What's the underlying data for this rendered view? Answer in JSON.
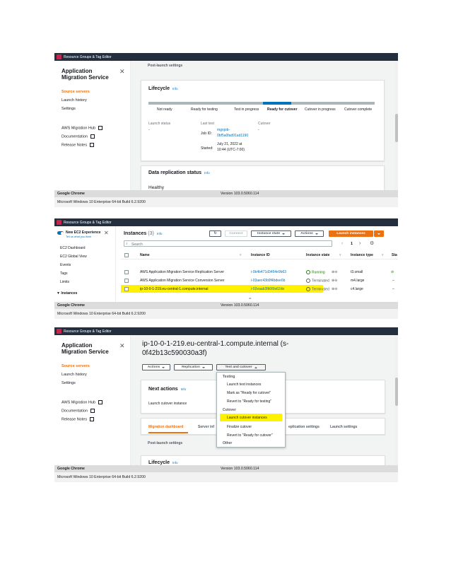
{
  "colors": {
    "aws_dark": "#232f3e",
    "aws_orange": "#ec7211",
    "link_blue": "#0073bb",
    "highlight": "#fff200",
    "running_green": "#1d8102"
  },
  "common": {
    "resource_groups": "Resource Groups & Tag Editor",
    "chrome_label": "Google Chrome",
    "chrome_version": "Version 103.0.5060.114",
    "windows_label": "Microsoft Windows 10 Enterprise 64-bit Build 6.2.9200"
  },
  "mgn_sidebar": {
    "title": "Application Migration Service",
    "items": [
      "Source servers",
      "Launch history",
      "Settings"
    ],
    "links": [
      "AWS Migration Hub",
      "Documentation",
      "Release Notes"
    ]
  },
  "screen1": {
    "post_launch": "Post-launch settings",
    "lifecycle_title": "Lifecycle",
    "info": "Info",
    "stages": [
      "Not ready",
      "Ready for testing",
      "Test in progress",
      "Ready for cutover",
      "Cutover in progress",
      "Cutover complete"
    ],
    "launch_status_label": "Launch status",
    "launch_status_value": "-",
    "last_test_label": "Last test",
    "job_id_label": "Job ID:",
    "job_id_line1": "mgnjob-",
    "job_id_line2": "0bf5a0fad91ad1190",
    "started_label": "Started:",
    "started_line1": "July 21, 2022 at",
    "started_line2": "10:44 (UTC-7:00)",
    "cutover_label": "Cutover",
    "cutover_value": "-",
    "data_replication_title": "Data replication status",
    "healthy": "Healthy"
  },
  "screen2": {
    "new_experience": "New EC2 Experience",
    "tell_us": "Tell us what you think",
    "nav": [
      "EC2 Dashboard",
      "EC2 Global View",
      "Events",
      "Tags",
      "Limits"
    ],
    "instances_nav": "Instances",
    "title": "Instances",
    "count": "(3)",
    "info": "Info",
    "connect": "Connect",
    "instance_state": "Instance state",
    "actions": "Actions",
    "launch_instances": "Launch instances",
    "search_placeholder": "Search",
    "page": "1",
    "columns": [
      "Name",
      "Instance ID",
      "Instance state",
      "Instance type",
      "Sta"
    ],
    "rows": [
      {
        "name": "AWS Application Migration Service Replication Server",
        "id": "i-0b4b471d3464e9b63",
        "state": "Running",
        "type": "t3.small",
        "sta": ""
      },
      {
        "name": "AWS Application Migration Service Conversion Server",
        "id": "i-03aec43b9f4bdee6b",
        "state": "Terminated",
        "type": "m4.large",
        "sta": "–"
      },
      {
        "name": "ip-10-0-1-219.eu-central-1.compute.internal",
        "id": "i-02eaab3fb06fa62de",
        "state": "Terminated",
        "type": "c4.large",
        "sta": "–"
      }
    ]
  },
  "screen3": {
    "server_title_line1": "ip-10-0-1-219.eu-central-1.compute.internal (s-",
    "server_title_line2": "0f42b13c590030a3f)",
    "actions": "Actions",
    "replication": "Replication",
    "test_cutover": "Test and cutover",
    "next_actions": "Next actions",
    "info": "Info",
    "launch_cutover_instance": "Launch cutover instance",
    "tabs": [
      "Migration dashboard",
      "Server inf",
      "eplication settings",
      "Launch settings"
    ],
    "post_launch": "Post-launch settings",
    "lifecycle": "Lifecycle",
    "menu": {
      "testing": "Testing",
      "launch_test": "Launch test instances",
      "mark_ready": "Mark as \"Ready for cutover\"",
      "revert_testing": "Revert to \"Ready for testing\"",
      "cutover": "Cutover",
      "launch_cutover": "Launch cutover instances",
      "finalize": "Finalize cutover",
      "revert_cutover": "Revert to \"Ready for cutover\"",
      "other": "Other"
    }
  }
}
